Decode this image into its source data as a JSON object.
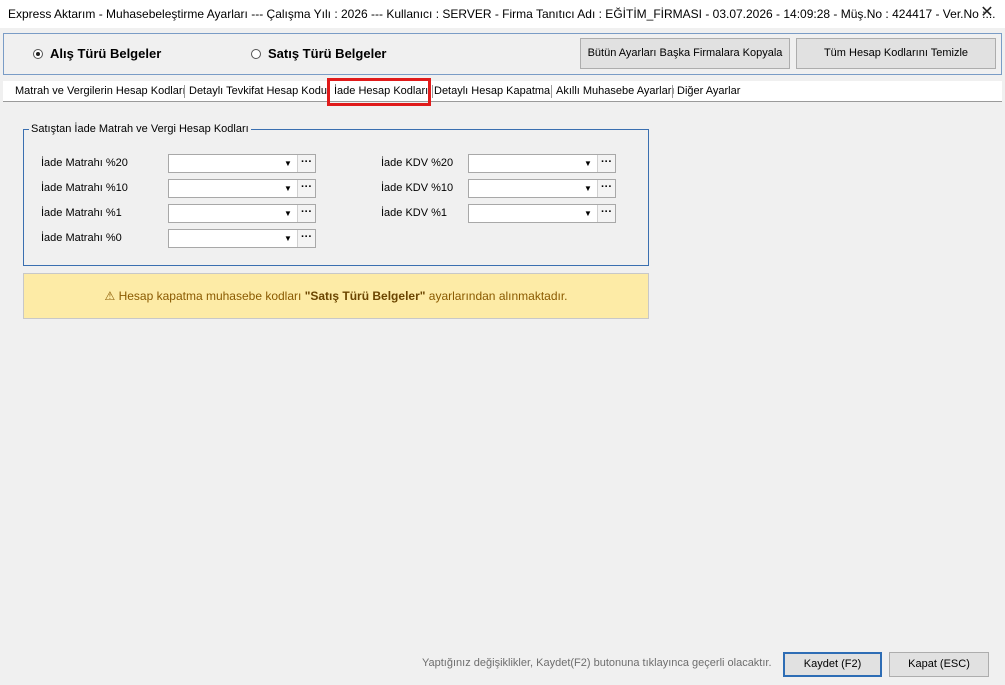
{
  "window": {
    "title": "Express Aktarım - Muhasebeleştirme Ayarları  ---  Çalışma Yılı : 2026  ---  Kullanıcı : SERVER - Firma Tanıtıcı Adı : EĞİTİM_FİRMASI - 03.07.2026 - 14:09:28 - Müş.No : 424417 - Ver.No :...",
    "close_label": "✕"
  },
  "doc_type": {
    "options": [
      {
        "label": "Alış Türü Belgeler",
        "selected": true
      },
      {
        "label": "Satış Türü Belgeler",
        "selected": false
      }
    ],
    "copy_button": "Bütün Ayarları Başka Firmalara Kopyala",
    "clear_button": "Tüm Hesap Kodlarını Temizle"
  },
  "tabs": [
    {
      "label": "Matrah ve Vergilerin Hesap Kodları",
      "active": false
    },
    {
      "label": "Detaylı Tevkifat Hesap Kodu",
      "active": false
    },
    {
      "label": "İade Hesap Kodları",
      "active": true
    },
    {
      "label": "Detaylı Hesap Kapatma",
      "active": false
    },
    {
      "label": "Akıllı Muhasebe Ayarları",
      "active": false
    },
    {
      "label": "Diğer Ayarlar",
      "active": false
    }
  ],
  "group": {
    "legend": "Satıştan İade Matrah ve Vergi Hesap Kodları",
    "matrah_fields": [
      {
        "label": "İade Matrahı %20",
        "value": ""
      },
      {
        "label": "İade Matrahı %10",
        "value": ""
      },
      {
        "label": "İade Matrahı %1",
        "value": ""
      },
      {
        "label": "İade Matrahı %0",
        "value": ""
      }
    ],
    "kdv_fields": [
      {
        "label": "İade KDV %20",
        "value": ""
      },
      {
        "label": "İade KDV %10",
        "value": ""
      },
      {
        "label": "İade KDV %1",
        "value": ""
      }
    ],
    "dropdown_glyph": "▼",
    "browse_glyph": "···"
  },
  "notice": {
    "icon": "⚠",
    "prefix": "Hesap kapatma muhasebe kodları ",
    "emphasis": "\"Satış Türü Belgeler\"",
    "suffix": " ayarlarından alınmaktadır."
  },
  "footer": {
    "hint": "Yaptığınız değişiklikler, Kaydet(F2) butonuna tıklayınca geçerli olacaktır.",
    "save_button": "Kaydet (F2)",
    "close_button": "Kapat (ESC)"
  }
}
